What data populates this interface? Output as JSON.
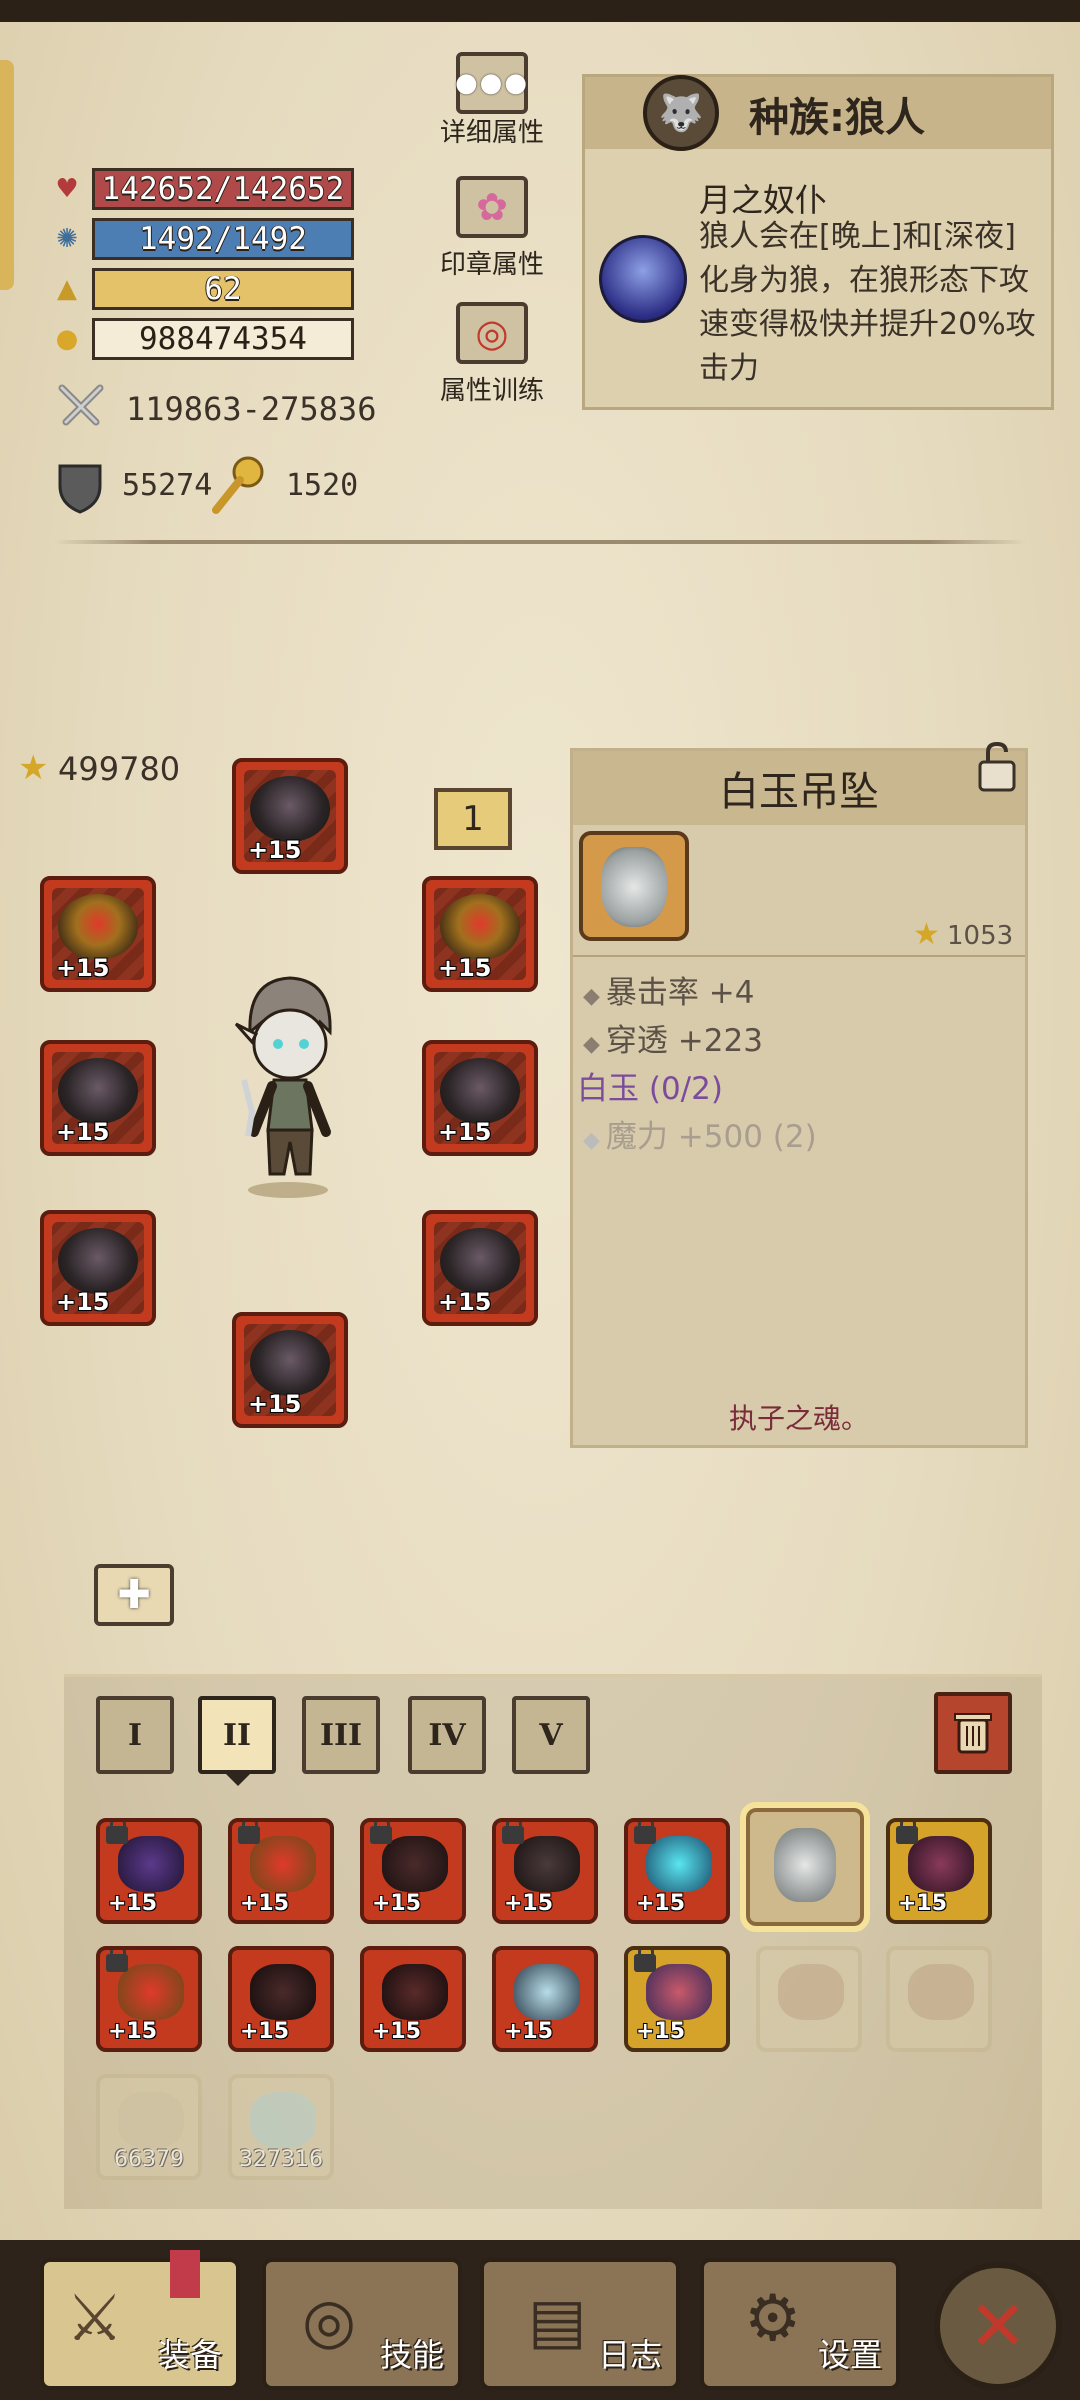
{
  "stats": {
    "hp": "142652/142652",
    "mp": "1492/1492",
    "level": "62",
    "gold": "988474354",
    "attack": "119863-275836",
    "armor": "55274",
    "luck": "1520"
  },
  "stat_buttons": [
    {
      "label": "详细属性",
      "icon": "dots-icon"
    },
    {
      "label": "印章属性",
      "icon": "flower-icon"
    },
    {
      "label": "属性训练",
      "icon": "target-icon"
    }
  ],
  "race": {
    "title": "种族:狼人",
    "skill_name": "月之奴仆",
    "description": "狼人会在[晚上]和[深夜]化身为狼，在狼形态下攻速变得极快并提升20%攻击力"
  },
  "score": "499780",
  "loadout_number": "1",
  "equipment_slots": [
    {
      "name": "helmet",
      "plus": "+15"
    },
    {
      "name": "amulet-left",
      "plus": "+15"
    },
    {
      "name": "weapon",
      "plus": "+15"
    },
    {
      "name": "gloves",
      "plus": "+15"
    },
    {
      "name": "necklace-right",
      "plus": "+15"
    },
    {
      "name": "armor",
      "plus": "+15"
    },
    {
      "name": "belt",
      "plus": "+15"
    },
    {
      "name": "boots",
      "plus": "+15"
    }
  ],
  "detail": {
    "title": "白玉吊坠",
    "power": "1053",
    "props": [
      "暴击率 +4",
      "穿透 +223"
    ],
    "set_name": "白玉 (0/2)",
    "set_bonus": "魔力 +500 (2)",
    "flavor": "执子之魂。"
  },
  "tiers": [
    "I",
    "II",
    "III",
    "IV",
    "V"
  ],
  "active_tier": 1,
  "inventory_row1": [
    "+15",
    "+15",
    "+15",
    "+15",
    "+15",
    "",
    "+15"
  ],
  "inventory_row2": [
    "+15",
    "+15",
    "+15",
    "+15",
    "+15"
  ],
  "inventory_row3": [
    "66379",
    "327316"
  ],
  "nav": [
    {
      "label": "装备"
    },
    {
      "label": "技能"
    },
    {
      "label": "日志"
    },
    {
      "label": "设置"
    }
  ],
  "colors": {
    "hp": "#b04a4a",
    "mp": "#4c7db3",
    "level": "#e3c26a",
    "slot_red": "#c33a1f",
    "selected": "#f6e39b"
  }
}
